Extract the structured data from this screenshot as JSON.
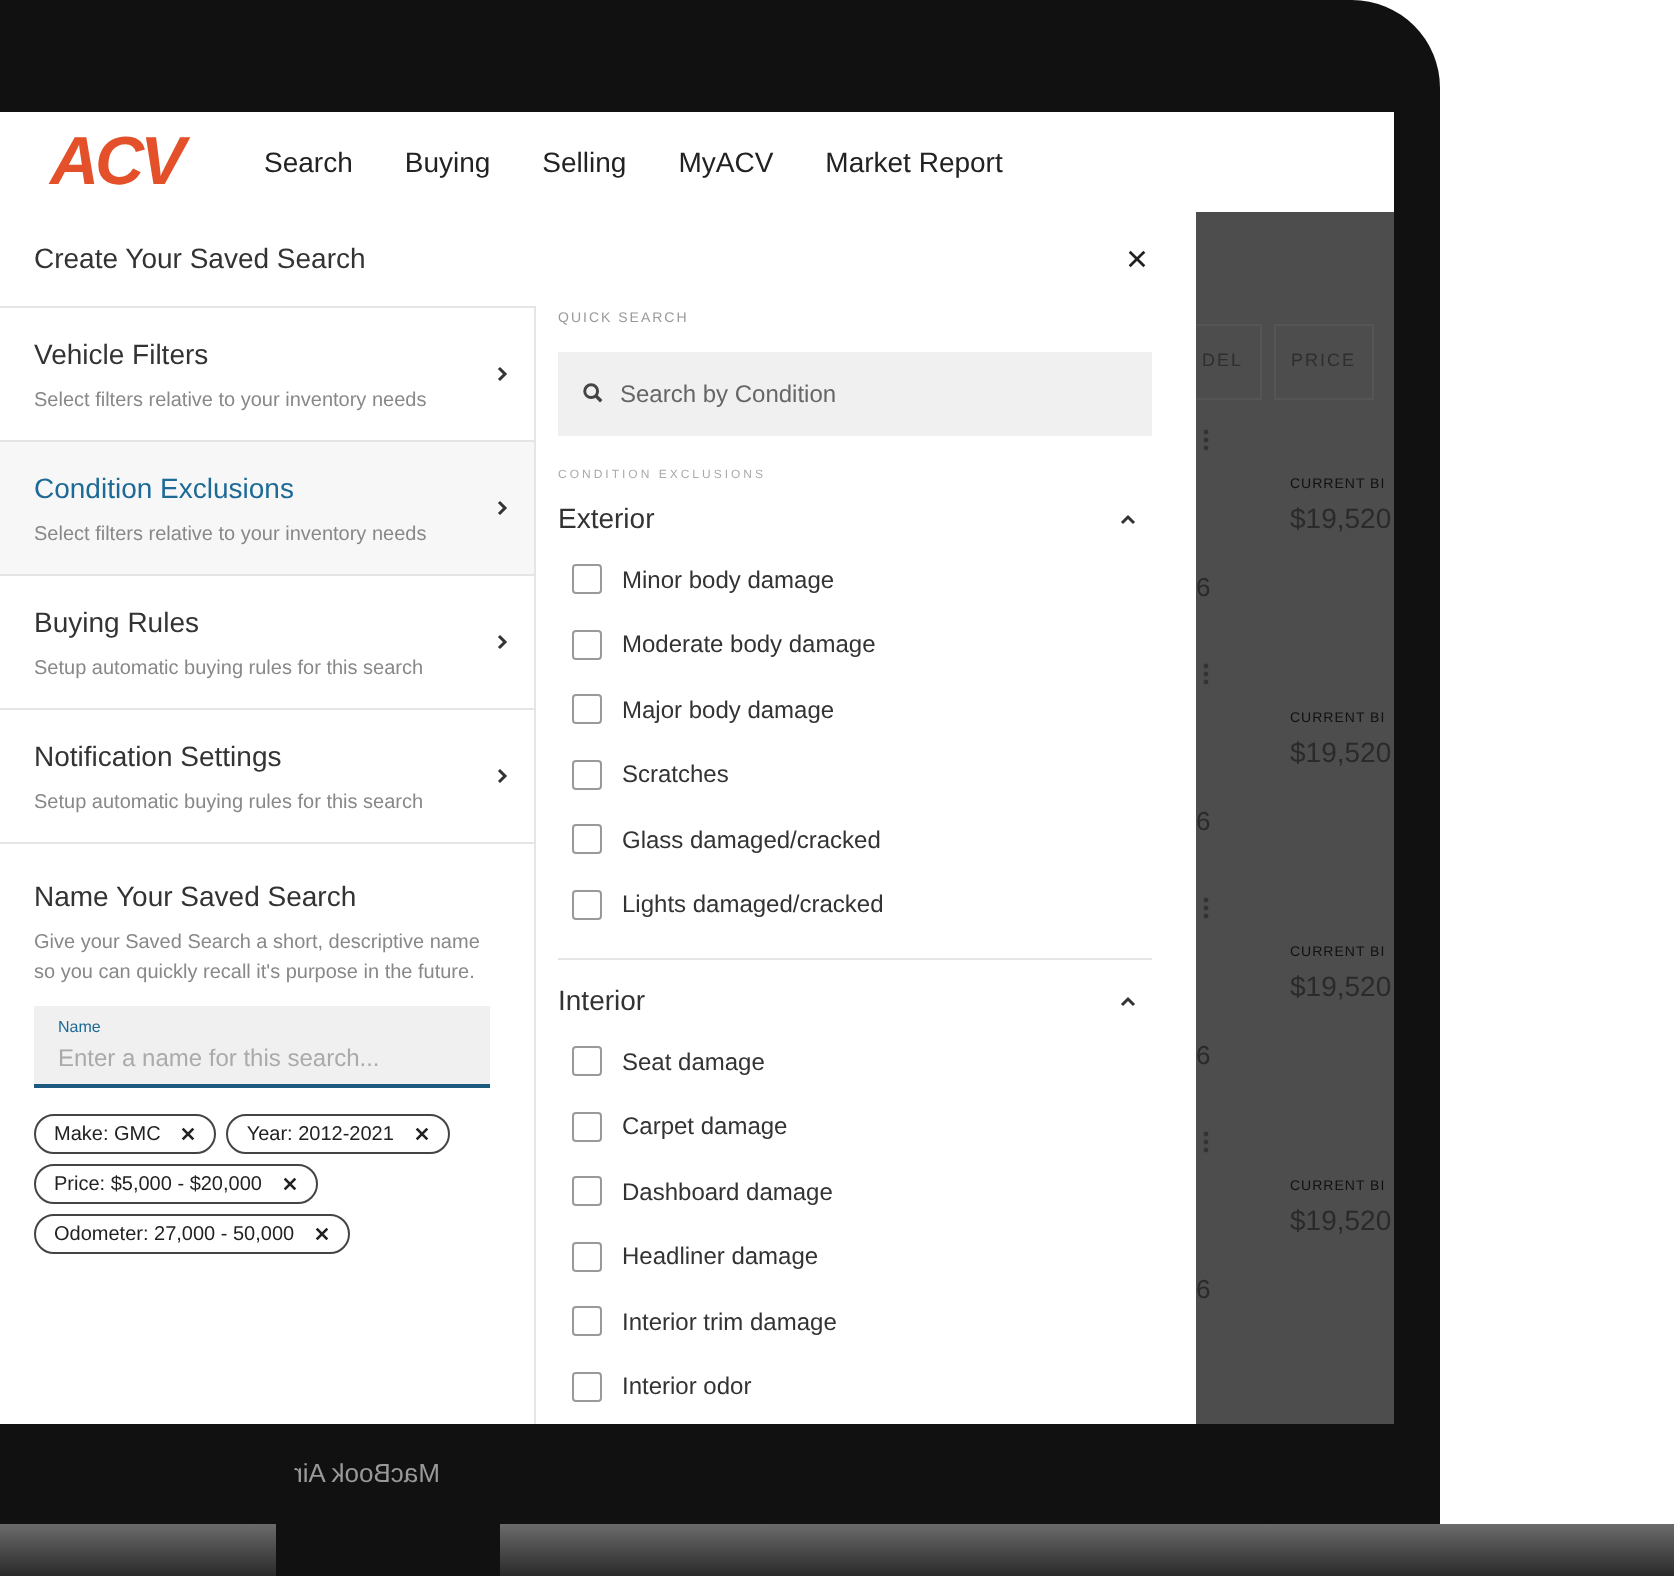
{
  "nav": {
    "logo": "ACV",
    "links": [
      "Search",
      "Buying",
      "Selling",
      "MyACV",
      "Market Report"
    ]
  },
  "drawer": {
    "title": "Create Your Saved Search",
    "steps": [
      {
        "title": "Vehicle Filters",
        "subtitle": "Select filters relative to your inventory needs",
        "selected": false
      },
      {
        "title": "Condition Exclusions",
        "subtitle": "Select filters relative to your inventory needs",
        "selected": true
      },
      {
        "title": "Buying Rules",
        "subtitle": "Setup automatic buying rules for this search",
        "selected": false
      },
      {
        "title": "Notification Settings",
        "subtitle": "Setup automatic buying rules for this search",
        "selected": false
      }
    ],
    "name_section": {
      "title": "Name Your Saved Search",
      "description": "Give your Saved Search a short, descriptive name so you can quickly recall it's purpose in the future.",
      "field": {
        "label": "Name",
        "placeholder": "Enter a name for this search..."
      }
    },
    "chips": [
      "Make: GMC",
      "Year: 2012-2021",
      "Price: $5,000 - $20,000",
      "Odometer: 27,000 - 50,000"
    ],
    "quick_search": {
      "label": "QUICK SEARCH",
      "placeholder": "Search by Condition"
    },
    "exclusions_label": "CONDITION EXCLUSIONS",
    "groups": [
      {
        "title": "Exterior",
        "expanded": true,
        "items": [
          {
            "label": "Minor body damage",
            "checked": false
          },
          {
            "label": "Moderate body damage",
            "checked": false
          },
          {
            "label": "Major body damage",
            "checked": false
          },
          {
            "label": "Scratches",
            "checked": false
          },
          {
            "label": "Glass damaged/cracked",
            "checked": false
          },
          {
            "label": "Lights damaged/cracked",
            "checked": false
          }
        ]
      },
      {
        "title": "Interior",
        "expanded": true,
        "items": [
          {
            "label": "Seat damage",
            "checked": false
          },
          {
            "label": "Carpet damage",
            "checked": false
          },
          {
            "label": "Dashboard damage",
            "checked": false
          },
          {
            "label": "Headliner damage",
            "checked": false
          },
          {
            "label": "Interior trim damage",
            "checked": false
          },
          {
            "label": "Interior odor",
            "checked": false
          }
        ]
      }
    ]
  },
  "background": {
    "columns": [
      "DEL",
      "PRICE"
    ],
    "rows": [
      {
        "label": "CURRENT BI",
        "price": "$19,520",
        "count": "6"
      },
      {
        "label": "CURRENT BI",
        "price": "$19,520",
        "count": "6"
      },
      {
        "label": "CURRENT BI",
        "price": "$19,520",
        "count": "6"
      },
      {
        "label": "CURRENT BI",
        "price": "$19,520",
        "count": "6"
      }
    ]
  },
  "device": {
    "label": "MacBook Air"
  }
}
